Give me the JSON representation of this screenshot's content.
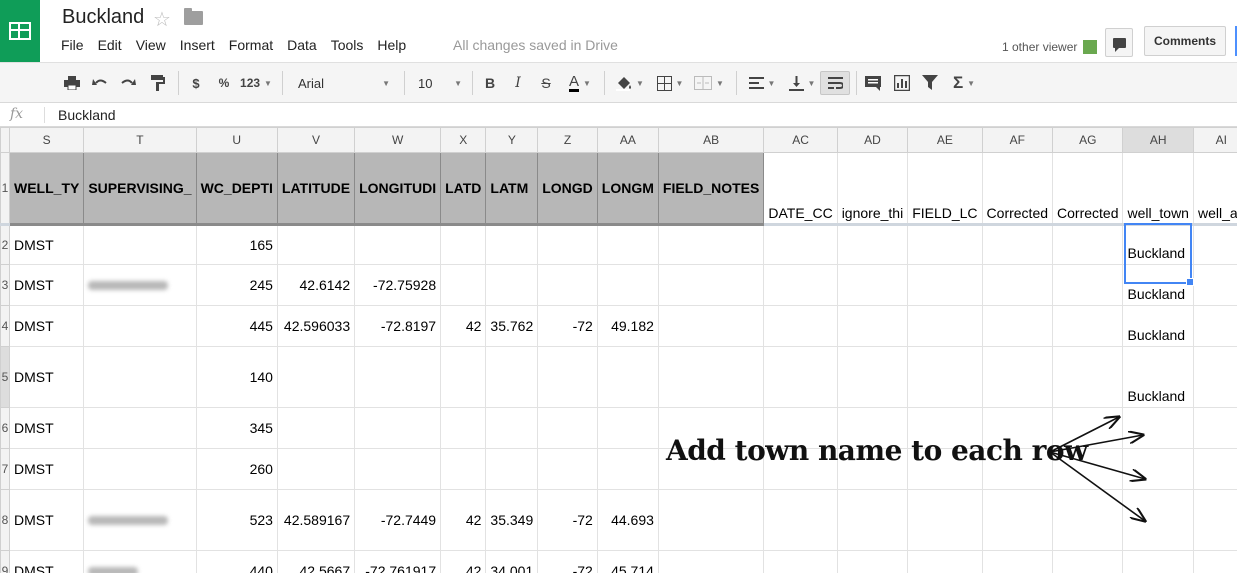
{
  "doc": {
    "title": "Buckland",
    "save_status": "All changes saved in Drive",
    "viewer_text": "1 other viewer",
    "comments_label": "Comments"
  },
  "menu": [
    "File",
    "Edit",
    "View",
    "Insert",
    "Format",
    "Data",
    "Tools",
    "Help"
  ],
  "toolbar": {
    "currency": "$",
    "percent": "%",
    "number_format": "123",
    "font": "Arial",
    "font_size": "10",
    "bold": "B",
    "italic": "I",
    "strike": "S",
    "text_color": "A",
    "sum": "Σ"
  },
  "formula_bar": {
    "fx": "fx",
    "content": "Buckland"
  },
  "grid": {
    "columns": [
      "S",
      "T",
      "U",
      "V",
      "W",
      "X",
      "Y",
      "Z",
      "AA",
      "AB",
      "AC",
      "AD",
      "AE",
      "AF",
      "AG",
      "AH",
      "AI"
    ],
    "header_row": {
      "row_number": "1",
      "cells": [
        "WELL_TY",
        "SUPERVISING_",
        "WC_DEPTI",
        "LATITUDE",
        "LONGITUDI",
        "LATD",
        "LATM",
        "LONGD",
        "LONGM",
        "FIELD_NOTES",
        "DATE_CC",
        "ignore_thi",
        "FIELD_LC",
        "Corrected",
        "Corrected",
        "well_town",
        "well_ac"
      ]
    },
    "rows": [
      {
        "n": "2",
        "cells": [
          "DMST",
          "",
          "165",
          "",
          "",
          "",
          "",
          "",
          "",
          "",
          "",
          "",
          "",
          "",
          "",
          "Buckland",
          ""
        ]
      },
      {
        "n": "3",
        "cells": [
          "DMST",
          "",
          "245",
          "42.6142",
          "-72.75928",
          "",
          "",
          "",
          "",
          "",
          "",
          "",
          "",
          "",
          "",
          "Buckland",
          ""
        ]
      },
      {
        "n": "4",
        "cells": [
          "DMST",
          "",
          "445",
          "42.596033",
          "-72.8197",
          "42",
          "35.762",
          "-72",
          "49.182",
          "",
          "",
          "",
          "",
          "",
          "",
          "Buckland",
          ""
        ]
      },
      {
        "n": "5",
        "cells": [
          "DMST",
          "",
          "140",
          "",
          "",
          "",
          "",
          "",
          "",
          "",
          "",
          "",
          "",
          "",
          "",
          "Buckland",
          ""
        ]
      },
      {
        "n": "6",
        "cells": [
          "DMST",
          "",
          "345",
          "",
          "",
          "",
          "",
          "",
          "",
          "",
          "",
          "",
          "",
          "",
          "",
          "",
          ""
        ]
      },
      {
        "n": "7",
        "cells": [
          "DMST",
          "",
          "260",
          "",
          "",
          "",
          "",
          "",
          "",
          "",
          "",
          "",
          "",
          "",
          "",
          "",
          ""
        ]
      },
      {
        "n": "8",
        "cells": [
          "DMST",
          "",
          "523",
          "42.589167",
          "-72.7449",
          "42",
          "35.349",
          "-72",
          "44.693",
          "",
          "",
          "",
          "",
          "",
          "",
          "",
          ""
        ]
      },
      {
        "n": "9",
        "cells": [
          "DMST",
          "",
          "440",
          "42.5667",
          "-72.761917",
          "42",
          "34.001",
          "-72",
          "45.714",
          "",
          "",
          "",
          "",
          "",
          "",
          "",
          ""
        ]
      }
    ]
  },
  "annotation": {
    "text": "Add town name to each row"
  }
}
